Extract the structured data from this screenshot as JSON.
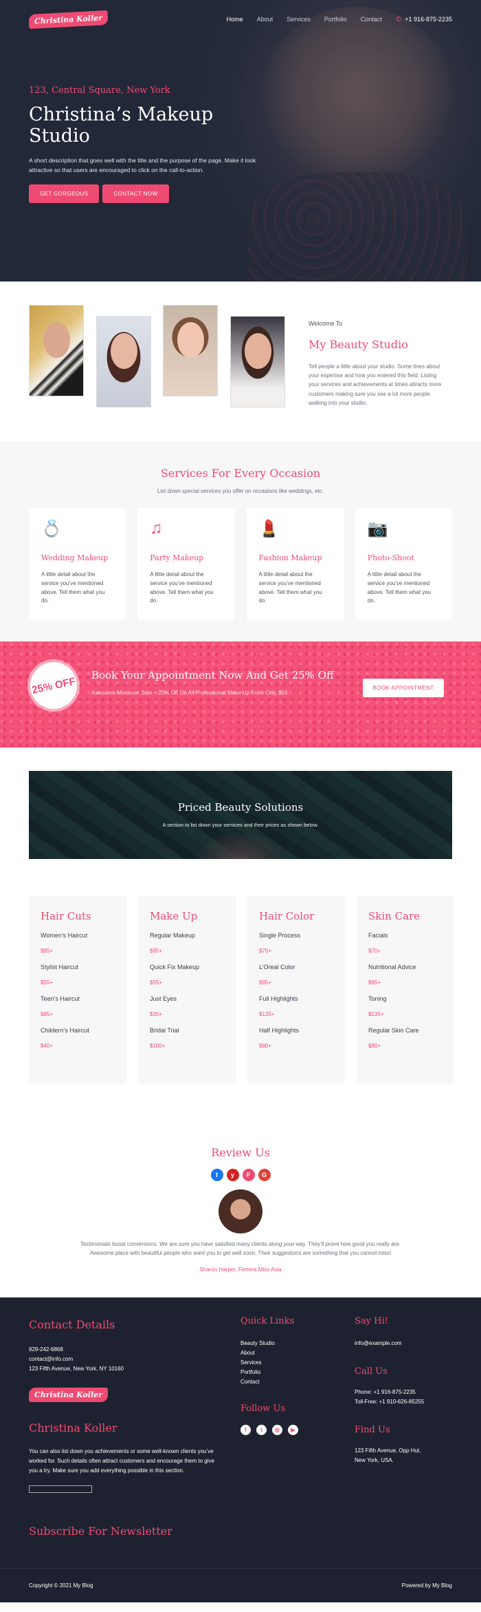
{
  "nav": {
    "logo": "Christina Koller",
    "links": [
      "Home",
      "About",
      "Services",
      "Portfolio",
      "Contact"
    ],
    "active": "Home",
    "phone": "+1 916-875-2235"
  },
  "hero": {
    "subtitle": "123, Central Square, New York",
    "title": "Christina’s Makeup Studio",
    "description": "A short description that goes well with the title and the purpose of the page. Make it look attractive so that users are encouraged to click on the call-to-action.",
    "btn_primary": "GET GORGEOUS",
    "btn_secondary": "CONTACT NOW"
  },
  "about": {
    "kicker": "Welcome To",
    "title": "My Beauty Studio",
    "text": "Tell people a little about your studio. Some lines about your expertise and how you entered this field. Listing your services and achievements at times attracts more customers making sure you see a lot more people walking into your studio."
  },
  "services": {
    "title": "Services For Every Occasion",
    "subtitle": "List down special services you offer on occasions like weddings, etc.",
    "cards": [
      {
        "icon": "ring-icon",
        "glyph": "💍",
        "title": "Wedding Makeup",
        "text": "A little detail about the service you’ve mentioned above. Tell them what you do."
      },
      {
        "icon": "music-notes-icon",
        "glyph": "♫",
        "title": "Party Makeup",
        "text": "A little detail about the service you’ve mentioned above. Tell them what you do."
      },
      {
        "icon": "cosmetics-icon",
        "glyph": "💄",
        "title": "Fashion Makeup",
        "text": "A little detail about the service you’ve mentioned above. Tell them what you do."
      },
      {
        "icon": "camera-heart-icon",
        "glyph": "📷",
        "title": "Photo-Shoot",
        "text": "A little detail about the service you’ve mentioned above. Tell them what you do."
      }
    ]
  },
  "promo": {
    "badge": "25% OFF",
    "title": "Book Your Appointment Now And Get 25% Off",
    "subtitle": "Awesome Monsoon Sale – 25% Off On All Professional Make Up From Only $59",
    "button": "BOOK APPOINTMENT"
  },
  "priced": {
    "title": "Priced Beauty Solutions",
    "subtitle": "A section to list down your services and their prices as shown below."
  },
  "prices": [
    {
      "title": "Hair Cuts",
      "items": [
        {
          "name": "Women’s Haircut",
          "price": "$95+"
        },
        {
          "name": "Stylist Haircut",
          "price": "$55+"
        },
        {
          "name": "Teen’s Haircut",
          "price": "$85+"
        },
        {
          "name": "Childern’s Haircut",
          "price": "$40+"
        }
      ]
    },
    {
      "title": "Make Up",
      "items": [
        {
          "name": "Regular Makeup",
          "price": "$95+"
        },
        {
          "name": "Quick Fix Makeup",
          "price": "$55+"
        },
        {
          "name": "Just Eyes",
          "price": "$35+"
        },
        {
          "name": "Bridal Trial",
          "price": "$100+"
        }
      ]
    },
    {
      "title": "Hair Color",
      "items": [
        {
          "name": "Single Process",
          "price": "$70+"
        },
        {
          "name": "L’Oreal Color",
          "price": "$95+"
        },
        {
          "name": "Full Highlights",
          "price": "$135+"
        },
        {
          "name": "Half Highlights",
          "price": "$80+"
        }
      ]
    },
    {
      "title": "Skin Care",
      "items": [
        {
          "name": "Facials",
          "price": "$70+"
        },
        {
          "name": "Nutritional Advice",
          "price": "$95+"
        },
        {
          "name": "Toning",
          "price": "$135+"
        },
        {
          "name": "Regular Skin Care",
          "price": "$80+"
        }
      ]
    }
  ],
  "review": {
    "title": "Review Us",
    "socials": [
      {
        "icon": "facebook-icon",
        "glyph": "f",
        "color": "#1877f2"
      },
      {
        "icon": "yelp-icon",
        "glyph": "y",
        "color": "#d32323"
      },
      {
        "icon": "foursquare-icon",
        "glyph": "F",
        "color": "#ef4b72"
      },
      {
        "icon": "google-icon",
        "glyph": "G",
        "color": "#db4437"
      }
    ],
    "text": "Testimonials boost conversions. We are sure you have satisfied many clients along your way. They’ll prove how good you really are. Awesome place with beautiful people who want you to get well soon. Their suggestions are something that you cannot miss!",
    "author": "Sharon Harper, Femina Miss Asia"
  },
  "footer": {
    "contact_title": "Contact Details",
    "contact_lines": [
      "929-242-6868",
      "contact@info.com",
      "123 Fifth Avenue, New York, NY 10160"
    ],
    "logo": "Christina Koller",
    "name": "Christina Koller",
    "bio": "You can also list down you achievements or some well-known clients you’ve worked for. Such details often attract customers and encourage them to give you a try. Make sure you add everything possible in this section.",
    "newsletter": "Subscribe For Newsletter",
    "quick_title": "Quick Links",
    "quick_links": [
      "Beauty Studio",
      "About",
      "Services",
      "Portfolio",
      "Contact"
    ],
    "follow_title": "Follow Us",
    "follow_icons": [
      {
        "icon": "facebook-icon",
        "glyph": "f"
      },
      {
        "icon": "twitter-icon",
        "glyph": "t"
      },
      {
        "icon": "instagram-icon",
        "glyph": "◎"
      },
      {
        "icon": "youtube-icon",
        "glyph": "▶"
      }
    ],
    "hi_title": "Say Hi!",
    "email": "info@example.com",
    "call_title": "Call Us",
    "phone": "Phone: +1 916-875-2235",
    "tollfree": "Toll-Free: +1 910-626-85255",
    "find_title": "Find Us",
    "address_1": "123 Fifth Avenue, Opp Hut,",
    "address_2": "New York, USA.",
    "copyright": "Copyright © 2021 My Blog",
    "powered": "Powered by My Blog"
  },
  "colors": {
    "accent": "#ef4b72",
    "dark": "#1e2230",
    "light": "#f7f7f8"
  }
}
